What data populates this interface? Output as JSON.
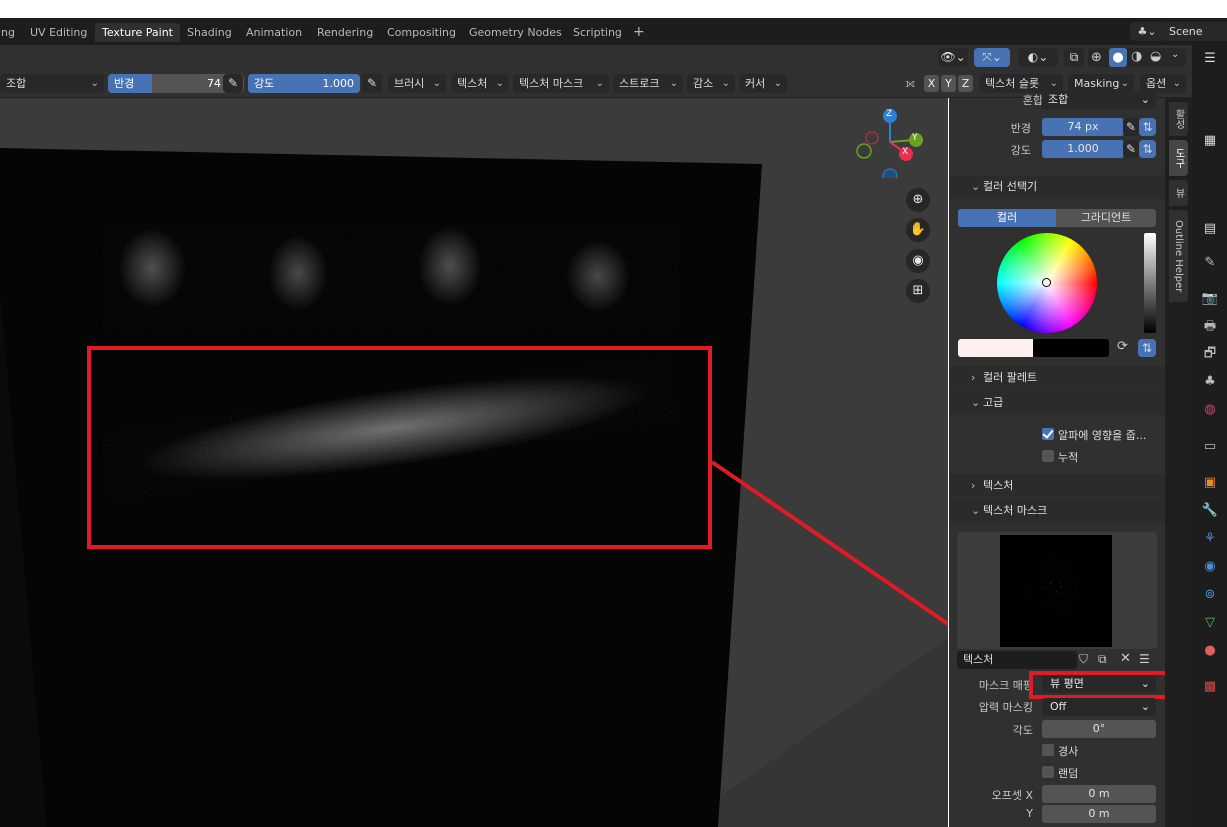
{
  "workspace_tabs": [
    {
      "label": "ing",
      "active": false
    },
    {
      "label": "UV Editing",
      "active": false
    },
    {
      "label": "Texture Paint",
      "active": true
    },
    {
      "label": "Shading",
      "active": false
    },
    {
      "label": "Animation",
      "active": false
    },
    {
      "label": "Rendering",
      "active": false
    },
    {
      "label": "Compositing",
      "active": false
    },
    {
      "label": "Geometry Nodes",
      "active": false
    },
    {
      "label": "Scripting",
      "active": false
    }
  ],
  "add_tab": "+",
  "scene": {
    "label": "Scene"
  },
  "toolbar": {
    "blend_mode": "조합",
    "radius": {
      "label": "반경",
      "value": "74 px",
      "fraction": 0.32
    },
    "strength": {
      "label": "강도",
      "value": "1.000",
      "fraction": 1.0
    },
    "menus": [
      "브러시",
      "텍스처",
      "텍스처 마스크",
      "스트로크",
      "감소",
      "커서"
    ],
    "axes": [
      "X",
      "Y",
      "Z"
    ],
    "texture_slots": "텍스처 슬롯",
    "masking": "Masking",
    "options": "옵션"
  },
  "panel": {
    "top_partial_label": "혼합",
    "top_partial_value": "조합",
    "radius": {
      "label": "반경",
      "value": "74 px"
    },
    "strength": {
      "label": "강도",
      "value": "1.000"
    },
    "color_picker": {
      "title": "컬러 선택기",
      "tab_color": "컬러",
      "tab_gradient": "그라디언트",
      "primary_color": "#fff0f0",
      "secondary_color": "#000000"
    },
    "color_palette": "컬러 팔레트",
    "advanced": {
      "title": "고급",
      "affect_alpha": "알파에 영향을 줍...",
      "affect_alpha_checked": true,
      "accumulate": "누적",
      "accumulate_checked": false
    },
    "texture": "텍스처",
    "texture_mask": {
      "title": "텍스처 마스크",
      "texture_label": "텍스처",
      "mask_mapping_label": "마스크 매핑",
      "mask_mapping_value": "뷰 평면",
      "pressure_mask_label": "압력 마스킹",
      "pressure_mask_value": "Off",
      "angle_label": "각도",
      "angle_value": "0°",
      "tilt": "경사",
      "random": "랜덤",
      "offset_x_label": "오프셋 X",
      "offset_x_value": "0 m",
      "offset_y_label": "Y",
      "offset_y_value": "0 m"
    }
  },
  "sidebar_tabs": [
    "활성",
    "도구",
    "뷰",
    "Outline Helper"
  ],
  "gizmo": {
    "x": "X",
    "y": "Y",
    "z": "Z"
  },
  "colors": {
    "accent_blue": "#4772b3",
    "highlight_red": "#e01b24",
    "axis_x": "#e8304c",
    "axis_y": "#6aa220",
    "axis_z": "#2e7fd8"
  }
}
